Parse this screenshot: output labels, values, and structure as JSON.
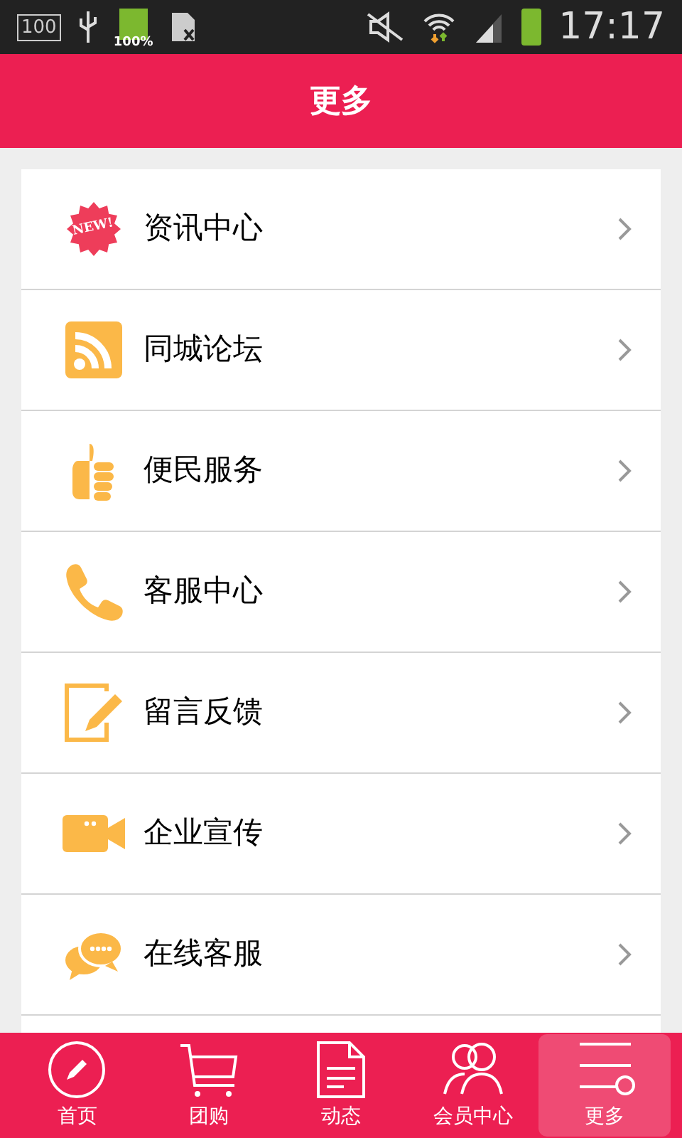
{
  "status_bar": {
    "notification_box": "100",
    "battery_percent": "100%",
    "time": "17:17"
  },
  "header": {
    "title": "更多"
  },
  "menu": [
    {
      "kind": "news",
      "badge": "NEW!",
      "label": "资讯中心"
    },
    {
      "kind": "rss",
      "label": "同城论坛"
    },
    {
      "kind": "thumb",
      "label": "便民服务"
    },
    {
      "kind": "phone",
      "label": "客服中心"
    },
    {
      "kind": "edit",
      "label": "留言反馈"
    },
    {
      "kind": "video",
      "label": "企业宣传"
    },
    {
      "kind": "chat",
      "label": "在线客服"
    }
  ],
  "tabs": [
    {
      "kind": "pencil",
      "label": "首页",
      "selected": false
    },
    {
      "kind": "cart",
      "label": "团购",
      "selected": false
    },
    {
      "kind": "doc",
      "label": "动态",
      "selected": false
    },
    {
      "kind": "users",
      "label": "会员中心",
      "selected": false
    },
    {
      "kind": "menu",
      "label": "更多",
      "selected": true
    }
  ]
}
